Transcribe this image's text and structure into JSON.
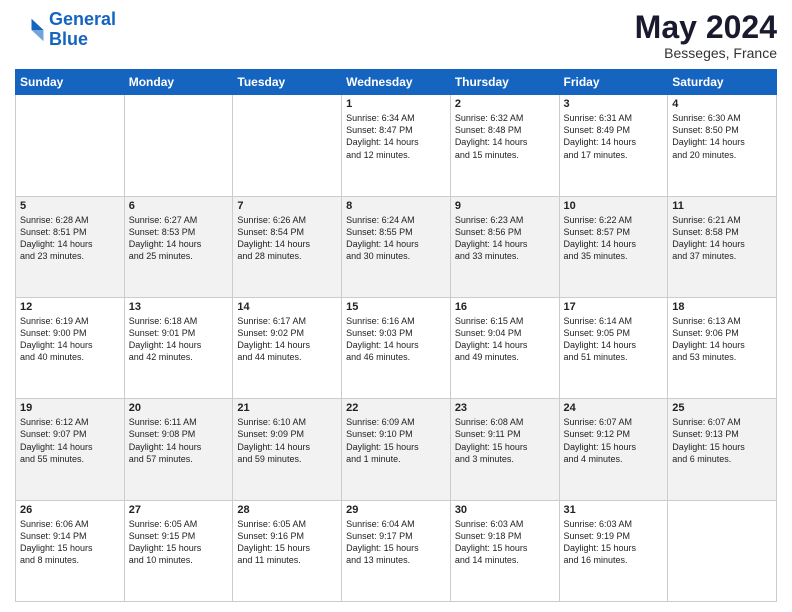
{
  "header": {
    "logo_line1": "General",
    "logo_line2": "Blue",
    "month_year": "May 2024",
    "location": "Besseges, France"
  },
  "days_of_week": [
    "Sunday",
    "Monday",
    "Tuesday",
    "Wednesday",
    "Thursday",
    "Friday",
    "Saturday"
  ],
  "weeks": [
    [
      {
        "day": "",
        "info": ""
      },
      {
        "day": "",
        "info": ""
      },
      {
        "day": "",
        "info": ""
      },
      {
        "day": "1",
        "info": "Sunrise: 6:34 AM\nSunset: 8:47 PM\nDaylight: 14 hours\nand 12 minutes."
      },
      {
        "day": "2",
        "info": "Sunrise: 6:32 AM\nSunset: 8:48 PM\nDaylight: 14 hours\nand 15 minutes."
      },
      {
        "day": "3",
        "info": "Sunrise: 6:31 AM\nSunset: 8:49 PM\nDaylight: 14 hours\nand 17 minutes."
      },
      {
        "day": "4",
        "info": "Sunrise: 6:30 AM\nSunset: 8:50 PM\nDaylight: 14 hours\nand 20 minutes."
      }
    ],
    [
      {
        "day": "5",
        "info": "Sunrise: 6:28 AM\nSunset: 8:51 PM\nDaylight: 14 hours\nand 23 minutes."
      },
      {
        "day": "6",
        "info": "Sunrise: 6:27 AM\nSunset: 8:53 PM\nDaylight: 14 hours\nand 25 minutes."
      },
      {
        "day": "7",
        "info": "Sunrise: 6:26 AM\nSunset: 8:54 PM\nDaylight: 14 hours\nand 28 minutes."
      },
      {
        "day": "8",
        "info": "Sunrise: 6:24 AM\nSunset: 8:55 PM\nDaylight: 14 hours\nand 30 minutes."
      },
      {
        "day": "9",
        "info": "Sunrise: 6:23 AM\nSunset: 8:56 PM\nDaylight: 14 hours\nand 33 minutes."
      },
      {
        "day": "10",
        "info": "Sunrise: 6:22 AM\nSunset: 8:57 PM\nDaylight: 14 hours\nand 35 minutes."
      },
      {
        "day": "11",
        "info": "Sunrise: 6:21 AM\nSunset: 8:58 PM\nDaylight: 14 hours\nand 37 minutes."
      }
    ],
    [
      {
        "day": "12",
        "info": "Sunrise: 6:19 AM\nSunset: 9:00 PM\nDaylight: 14 hours\nand 40 minutes."
      },
      {
        "day": "13",
        "info": "Sunrise: 6:18 AM\nSunset: 9:01 PM\nDaylight: 14 hours\nand 42 minutes."
      },
      {
        "day": "14",
        "info": "Sunrise: 6:17 AM\nSunset: 9:02 PM\nDaylight: 14 hours\nand 44 minutes."
      },
      {
        "day": "15",
        "info": "Sunrise: 6:16 AM\nSunset: 9:03 PM\nDaylight: 14 hours\nand 46 minutes."
      },
      {
        "day": "16",
        "info": "Sunrise: 6:15 AM\nSunset: 9:04 PM\nDaylight: 14 hours\nand 49 minutes."
      },
      {
        "day": "17",
        "info": "Sunrise: 6:14 AM\nSunset: 9:05 PM\nDaylight: 14 hours\nand 51 minutes."
      },
      {
        "day": "18",
        "info": "Sunrise: 6:13 AM\nSunset: 9:06 PM\nDaylight: 14 hours\nand 53 minutes."
      }
    ],
    [
      {
        "day": "19",
        "info": "Sunrise: 6:12 AM\nSunset: 9:07 PM\nDaylight: 14 hours\nand 55 minutes."
      },
      {
        "day": "20",
        "info": "Sunrise: 6:11 AM\nSunset: 9:08 PM\nDaylight: 14 hours\nand 57 minutes."
      },
      {
        "day": "21",
        "info": "Sunrise: 6:10 AM\nSunset: 9:09 PM\nDaylight: 14 hours\nand 59 minutes."
      },
      {
        "day": "22",
        "info": "Sunrise: 6:09 AM\nSunset: 9:10 PM\nDaylight: 15 hours\nand 1 minute."
      },
      {
        "day": "23",
        "info": "Sunrise: 6:08 AM\nSunset: 9:11 PM\nDaylight: 15 hours\nand 3 minutes."
      },
      {
        "day": "24",
        "info": "Sunrise: 6:07 AM\nSunset: 9:12 PM\nDaylight: 15 hours\nand 4 minutes."
      },
      {
        "day": "25",
        "info": "Sunrise: 6:07 AM\nSunset: 9:13 PM\nDaylight: 15 hours\nand 6 minutes."
      }
    ],
    [
      {
        "day": "26",
        "info": "Sunrise: 6:06 AM\nSunset: 9:14 PM\nDaylight: 15 hours\nand 8 minutes."
      },
      {
        "day": "27",
        "info": "Sunrise: 6:05 AM\nSunset: 9:15 PM\nDaylight: 15 hours\nand 10 minutes."
      },
      {
        "day": "28",
        "info": "Sunrise: 6:05 AM\nSunset: 9:16 PM\nDaylight: 15 hours\nand 11 minutes."
      },
      {
        "day": "29",
        "info": "Sunrise: 6:04 AM\nSunset: 9:17 PM\nDaylight: 15 hours\nand 13 minutes."
      },
      {
        "day": "30",
        "info": "Sunrise: 6:03 AM\nSunset: 9:18 PM\nDaylight: 15 hours\nand 14 minutes."
      },
      {
        "day": "31",
        "info": "Sunrise: 6:03 AM\nSunset: 9:19 PM\nDaylight: 15 hours\nand 16 minutes."
      },
      {
        "day": "",
        "info": ""
      }
    ]
  ]
}
